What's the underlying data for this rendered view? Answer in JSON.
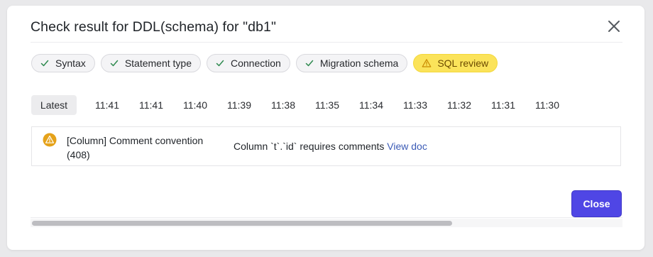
{
  "dialog": {
    "title": "Check result for DDL(schema) for \"db1\"",
    "close_button_label": "Close"
  },
  "checks": [
    {
      "label": "Syntax",
      "status": "success",
      "icon": "check-icon"
    },
    {
      "label": "Statement type",
      "status": "success",
      "icon": "check-icon"
    },
    {
      "label": "Connection",
      "status": "success",
      "icon": "check-icon"
    },
    {
      "label": "Migration schema",
      "status": "success",
      "icon": "check-icon"
    },
    {
      "label": "SQL review",
      "status": "warning",
      "icon": "warning-icon"
    }
  ],
  "timeline": {
    "items": [
      "Latest",
      "11:41",
      "11:41",
      "11:40",
      "11:39",
      "11:38",
      "11:35",
      "11:34",
      "11:33",
      "11:32",
      "11:31",
      "11:30"
    ]
  },
  "result": {
    "rule_title": "[Column] Comment convention (408)",
    "message": "Column `t`.`id` requires comments",
    "link_label": "View doc",
    "icon": "warning-icon"
  },
  "scrollbar": {
    "position": 0.0,
    "visible_fraction": 0.71
  },
  "colors": {
    "primary": "#4f46e5",
    "success": "#2f8a4f",
    "warning_bg": "#fbe35a",
    "warning_icon": "#e5a21a",
    "link": "#3b5bb6"
  }
}
